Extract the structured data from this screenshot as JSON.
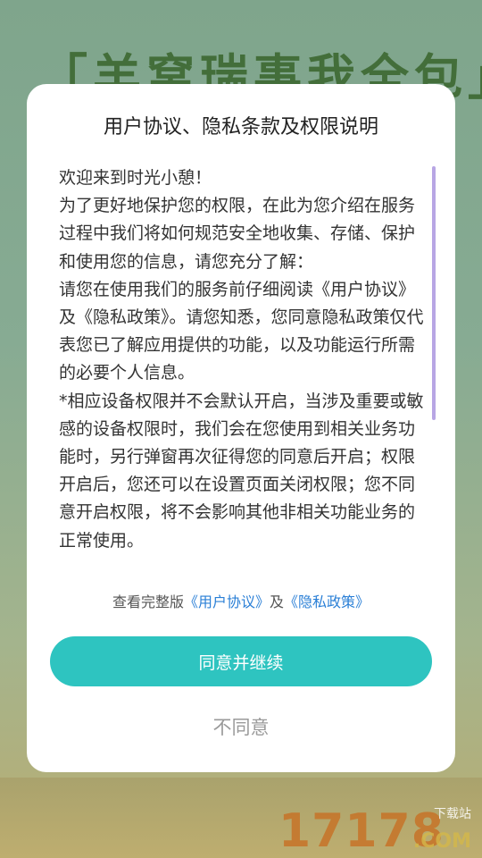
{
  "background": {
    "banner_text": "「羊窝瑞事我全包」",
    "watermark": {
      "number": "17178",
      "top_label": "下载站",
      "suffix": ".COM"
    }
  },
  "dialog": {
    "title": "用户协议、隐私条款及权限说明",
    "body_paragraphs": [
      "欢迎来到时光小憩！",
      "为了更好地保护您的权限，在此为您介绍在服务过程中我们将如何规范安全地收集、存储、保护和使用您的信息，请您充分了解：",
      "请您在使用我们的服务前仔细阅读《用户协议》及《隐私政策》。请您知悉，您同意隐私政策仅代表您已了解应用提供的功能，以及功能运行所需的必要个人信息。",
      "*相应设备权限并不会默认开启，当涉及重要或敏感的设备权限时，我们会在您使用到相关业务功能时，另行弹窗再次征得您的同意后开启；权限开启后，您还可以在设置页面关闭权限；您不同意开启权限，将不会影响其他非相关功能业务的正常使用。"
    ],
    "links_prefix": "查看完整版",
    "user_agreement_link": "《用户协议》",
    "links_joiner": "及",
    "privacy_policy_link": "《隐私政策》",
    "agree_label": "同意并继续",
    "disagree_label": "不同意"
  },
  "colors": {
    "accent": "#2ec4c0",
    "link": "#2a7fd6",
    "scrollbar": "#b8a6e4"
  }
}
